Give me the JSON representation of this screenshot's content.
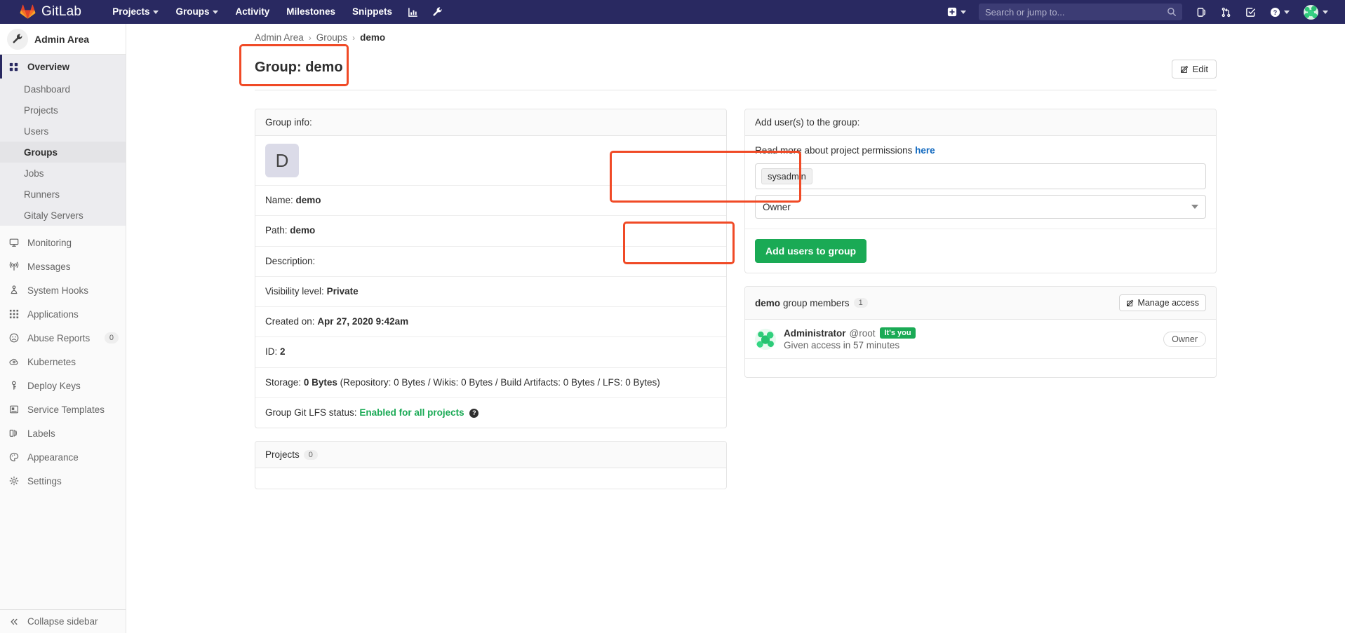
{
  "topnav": {
    "brand": "GitLab",
    "links": [
      {
        "label": "Projects",
        "caret": true,
        "name": "topnav-projects"
      },
      {
        "label": "Groups",
        "caret": true,
        "name": "topnav-groups"
      },
      {
        "label": "Activity",
        "caret": false,
        "name": "topnav-activity"
      },
      {
        "label": "Milestones",
        "caret": false,
        "name": "topnav-milestones"
      },
      {
        "label": "Snippets",
        "caret": false,
        "name": "topnav-snippets"
      }
    ],
    "icons": [
      "chart-icon",
      "wrench-icon"
    ],
    "search_placeholder": "Search or jump to...",
    "right_icons": [
      "plus-icon",
      "issues-icon",
      "merge-requests-icon",
      "todos-icon",
      "help-icon",
      "user-avatar"
    ]
  },
  "sidebar": {
    "context_title": "Admin Area",
    "overview": {
      "label": "Overview",
      "children": [
        {
          "label": "Dashboard",
          "selected": false
        },
        {
          "label": "Projects",
          "selected": false
        },
        {
          "label": "Users",
          "selected": false
        },
        {
          "label": "Groups",
          "selected": true
        },
        {
          "label": "Jobs",
          "selected": false
        },
        {
          "label": "Runners",
          "selected": false
        },
        {
          "label": "Gitaly Servers",
          "selected": false
        }
      ]
    },
    "items": [
      {
        "label": "Monitoring",
        "icon": "monitor-icon",
        "count": ""
      },
      {
        "label": "Messages",
        "icon": "broadcast-icon",
        "count": ""
      },
      {
        "label": "System Hooks",
        "icon": "hook-icon",
        "count": ""
      },
      {
        "label": "Applications",
        "icon": "apps-grid-icon",
        "count": ""
      },
      {
        "label": "Abuse Reports",
        "icon": "sad-face-icon",
        "count": "0"
      },
      {
        "label": "Kubernetes",
        "icon": "cloud-gear-icon",
        "count": ""
      },
      {
        "label": "Deploy Keys",
        "icon": "key-icon",
        "count": ""
      },
      {
        "label": "Service Templates",
        "icon": "template-icon",
        "count": ""
      },
      {
        "label": "Labels",
        "icon": "labels-icon",
        "count": ""
      },
      {
        "label": "Appearance",
        "icon": "palette-icon",
        "count": ""
      },
      {
        "label": "Settings",
        "icon": "settings-gear-icon",
        "count": ""
      }
    ],
    "collapse_label": "Collapse sidebar"
  },
  "breadcrumb": {
    "items": [
      "Admin Area",
      "Groups"
    ],
    "current": "demo",
    "separator": "›"
  },
  "page": {
    "title": "Group: demo",
    "edit_button": "Edit"
  },
  "group_info": {
    "header": "Group info:",
    "avatar_letter": "D",
    "name_label": "Name:",
    "name_value": "demo",
    "path_label": "Path:",
    "path_value": "demo",
    "description_label": "Description:",
    "description_value": "",
    "visibility_label": "Visibility level:",
    "visibility_value": "Private",
    "created_label": "Created on:",
    "created_value": "Apr 27, 2020 9:42am",
    "id_label": "ID:",
    "id_value": "2",
    "storage_label": "Storage:",
    "storage_value": "0 Bytes",
    "storage_detail": "(Repository: 0 Bytes / Wikis: 0 Bytes / Build Artifacts: 0 Bytes / LFS: 0 Bytes)",
    "lfs_label": "Group Git LFS status:",
    "lfs_value": "Enabled for all projects"
  },
  "projects_card": {
    "header": "Projects",
    "count": "0"
  },
  "add_users": {
    "header": "Add user(s) to the group:",
    "read_more_text": "Read more about project permissions",
    "read_more_link": "here",
    "user_token": "sysadmin",
    "access_level": "Owner",
    "submit_label": "Add users to group"
  },
  "members": {
    "title_group": "demo",
    "title_rest": "group members",
    "count": "1",
    "manage_access_label": "Manage access",
    "rows": [
      {
        "name": "Administrator",
        "handle": "@root",
        "badge": "It's you",
        "sub": "Given access in 57 minutes",
        "role": "Owner"
      }
    ]
  }
}
